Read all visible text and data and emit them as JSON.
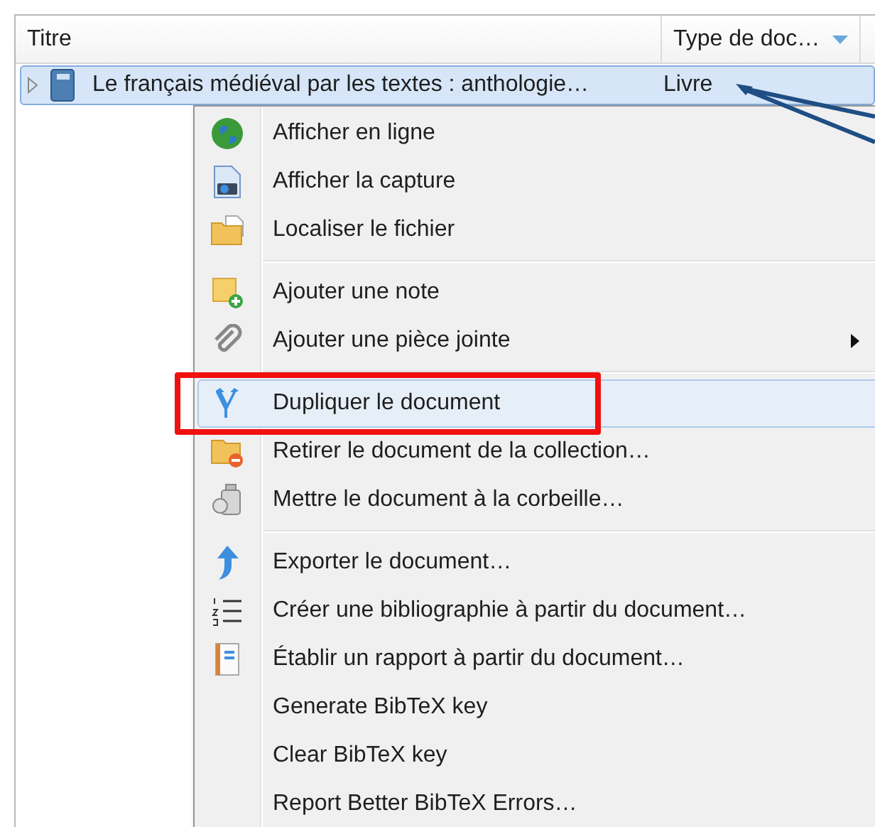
{
  "table": {
    "columns": [
      {
        "label": "Titre",
        "sorted": false
      },
      {
        "label": "Type de doc…",
        "sorted": true
      }
    ],
    "rows": [
      {
        "title": "Le français médiéval par les textes : anthologie…",
        "type": "Livre",
        "selected": true,
        "expanded": false
      }
    ]
  },
  "context_menu": {
    "items": [
      {
        "kind": "item",
        "label": "Afficher en ligne",
        "selected": false
      },
      {
        "kind": "item",
        "label": "Afficher la capture",
        "selected": false
      },
      {
        "kind": "item",
        "label": "Localiser le fichier",
        "selected": false
      },
      {
        "kind": "separator"
      },
      {
        "kind": "item",
        "label": "Ajouter une note",
        "selected": false
      },
      {
        "kind": "item",
        "label": "Ajouter une pièce jointe",
        "selected": false,
        "submenu": true
      },
      {
        "kind": "separator"
      },
      {
        "kind": "item",
        "label": "Dupliquer le document",
        "selected": true,
        "highlighted": true
      },
      {
        "kind": "item",
        "label": "Retirer le document de la collection…",
        "selected": false
      },
      {
        "kind": "item",
        "label": "Mettre le document à la corbeille…",
        "selected": false
      },
      {
        "kind": "separator"
      },
      {
        "kind": "item",
        "label": "Exporter le document…",
        "selected": false
      },
      {
        "kind": "item",
        "label": "Créer une bibliographie à partir du document…",
        "selected": false
      },
      {
        "kind": "item",
        "label": "Établir un rapport à partir du document…",
        "selected": false
      },
      {
        "kind": "item",
        "label": "Generate BibTeX key",
        "selected": false
      },
      {
        "kind": "item",
        "label": "Clear BibTeX key",
        "selected": false
      },
      {
        "kind": "item",
        "label": "Report Better BibTeX Errors…",
        "selected": false
      }
    ]
  }
}
